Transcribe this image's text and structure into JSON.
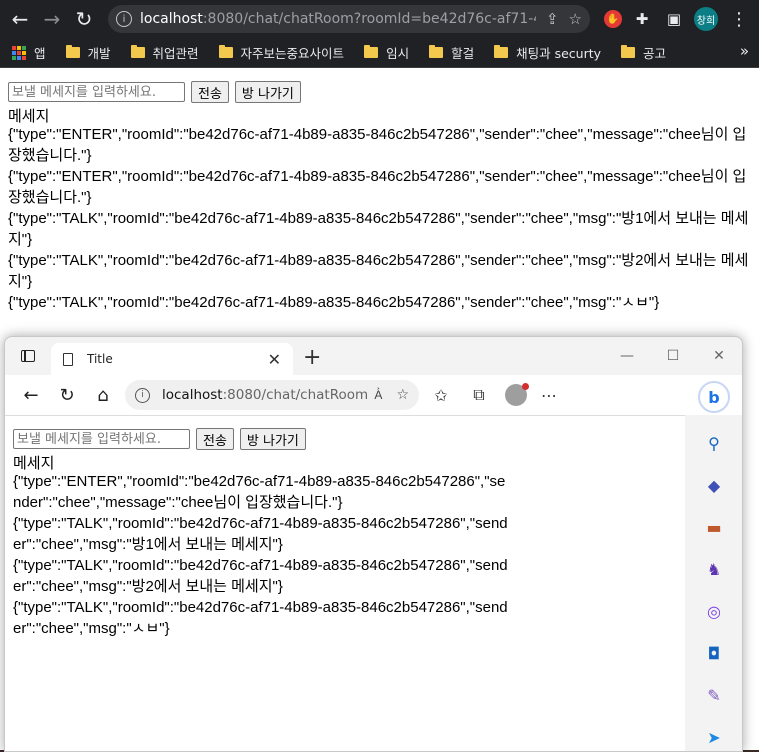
{
  "chrome": {
    "url_host": "localhost",
    "url_rest": ":8080/chat/chatRoom?roomId=be42d76c-af71-4b...",
    "profile_label": "창희",
    "bookmarks": [
      "앱",
      "개발",
      "취업관련",
      "자주보는중요사이트",
      "임시",
      "할걸",
      "채팅과 securty",
      "공고"
    ],
    "more": "»"
  },
  "page": {
    "input_placeholder": "보낼 메세지를 입력하세요.",
    "send_label": "전송",
    "leave_label": "방 나가기",
    "messages_title": "메세지",
    "messages_top": [
      "{\"type\":\"ENTER\",\"roomId\":\"be42d76c-af71-4b89-a835-846c2b547286\",\"sender\":\"chee\",\"message\":\"chee님이 입장했습니다.\"}",
      "{\"type\":\"ENTER\",\"roomId\":\"be42d76c-af71-4b89-a835-846c2b547286\",\"sender\":\"chee\",\"message\":\"chee님이 입장했습니다.\"}",
      "{\"type\":\"TALK\",\"roomId\":\"be42d76c-af71-4b89-a835-846c2b547286\",\"sender\":\"chee\",\"msg\":\"방1에서 보내는 메세지\"}",
      "{\"type\":\"TALK\",\"roomId\":\"be42d76c-af71-4b89-a835-846c2b547286\",\"sender\":\"chee\",\"msg\":\"방2에서 보내는 메세지\"}",
      "{\"type\":\"TALK\",\"roomId\":\"be42d76c-af71-4b89-a835-846c2b547286\",\"sender\":\"chee\",\"msg\":\"ㅅㅂ\"}"
    ],
    "messages_bottom": [
      "{\"type\":\"ENTER\",\"roomId\":\"be42d76c-af71-4b89-a835-846c2b547286\",\"sender\":\"chee\",\"message\":\"chee님이 입장했습니다.\"}",
      "{\"type\":\"TALK\",\"roomId\":\"be42d76c-af71-4b89-a835-846c2b547286\",\"sender\":\"chee\",\"msg\":\"방1에서 보내는 메세지\"}",
      "{\"type\":\"TALK\",\"roomId\":\"be42d76c-af71-4b89-a835-846c2b547286\",\"sender\":\"chee\",\"msg\":\"방2에서 보내는 메세지\"}",
      "{\"type\":\"TALK\",\"roomId\":\"be42d76c-af71-4b89-a835-846c2b547286\",\"sender\":\"chee\",\"msg\":\"ㅅㅂ\"}"
    ]
  },
  "edge": {
    "tab_title": "Title",
    "url_host": "localhost",
    "url_rest": ":8080/chat/chatRoom?ro...",
    "sidebar_icons": [
      "search-icon",
      "tag-icon",
      "briefcase-icon",
      "chess-icon",
      "office-icon",
      "outlook-icon",
      "drop-icon",
      "send-icon"
    ]
  },
  "colors": {
    "chrome_dark": "#202124",
    "omnibox": "#35363a",
    "folder": "#f2c94c",
    "edge_frame": "#f3f3f3"
  }
}
